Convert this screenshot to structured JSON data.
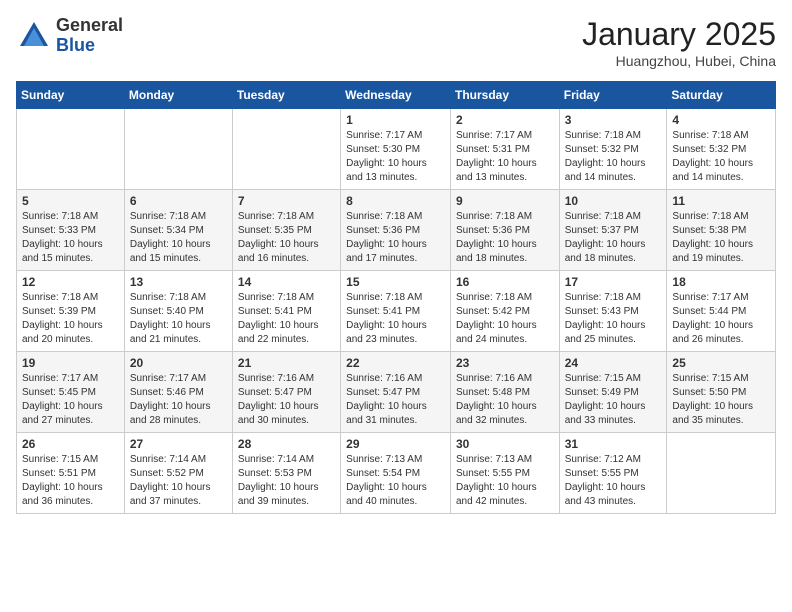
{
  "logo": {
    "general": "General",
    "blue": "Blue"
  },
  "header": {
    "month": "January 2025",
    "location": "Huangzhou, Hubei, China"
  },
  "weekdays": [
    "Sunday",
    "Monday",
    "Tuesday",
    "Wednesday",
    "Thursday",
    "Friday",
    "Saturday"
  ],
  "weeks": [
    [
      {
        "day": "",
        "sunrise": "",
        "sunset": "",
        "daylight": ""
      },
      {
        "day": "",
        "sunrise": "",
        "sunset": "",
        "daylight": ""
      },
      {
        "day": "",
        "sunrise": "",
        "sunset": "",
        "daylight": ""
      },
      {
        "day": "1",
        "sunrise": "Sunrise: 7:17 AM",
        "sunset": "Sunset: 5:30 PM",
        "daylight": "Daylight: 10 hours and 13 minutes."
      },
      {
        "day": "2",
        "sunrise": "Sunrise: 7:17 AM",
        "sunset": "Sunset: 5:31 PM",
        "daylight": "Daylight: 10 hours and 13 minutes."
      },
      {
        "day": "3",
        "sunrise": "Sunrise: 7:18 AM",
        "sunset": "Sunset: 5:32 PM",
        "daylight": "Daylight: 10 hours and 14 minutes."
      },
      {
        "day": "4",
        "sunrise": "Sunrise: 7:18 AM",
        "sunset": "Sunset: 5:32 PM",
        "daylight": "Daylight: 10 hours and 14 minutes."
      }
    ],
    [
      {
        "day": "5",
        "sunrise": "Sunrise: 7:18 AM",
        "sunset": "Sunset: 5:33 PM",
        "daylight": "Daylight: 10 hours and 15 minutes."
      },
      {
        "day": "6",
        "sunrise": "Sunrise: 7:18 AM",
        "sunset": "Sunset: 5:34 PM",
        "daylight": "Daylight: 10 hours and 15 minutes."
      },
      {
        "day": "7",
        "sunrise": "Sunrise: 7:18 AM",
        "sunset": "Sunset: 5:35 PM",
        "daylight": "Daylight: 10 hours and 16 minutes."
      },
      {
        "day": "8",
        "sunrise": "Sunrise: 7:18 AM",
        "sunset": "Sunset: 5:36 PM",
        "daylight": "Daylight: 10 hours and 17 minutes."
      },
      {
        "day": "9",
        "sunrise": "Sunrise: 7:18 AM",
        "sunset": "Sunset: 5:36 PM",
        "daylight": "Daylight: 10 hours and 18 minutes."
      },
      {
        "day": "10",
        "sunrise": "Sunrise: 7:18 AM",
        "sunset": "Sunset: 5:37 PM",
        "daylight": "Daylight: 10 hours and 18 minutes."
      },
      {
        "day": "11",
        "sunrise": "Sunrise: 7:18 AM",
        "sunset": "Sunset: 5:38 PM",
        "daylight": "Daylight: 10 hours and 19 minutes."
      }
    ],
    [
      {
        "day": "12",
        "sunrise": "Sunrise: 7:18 AM",
        "sunset": "Sunset: 5:39 PM",
        "daylight": "Daylight: 10 hours and 20 minutes."
      },
      {
        "day": "13",
        "sunrise": "Sunrise: 7:18 AM",
        "sunset": "Sunset: 5:40 PM",
        "daylight": "Daylight: 10 hours and 21 minutes."
      },
      {
        "day": "14",
        "sunrise": "Sunrise: 7:18 AM",
        "sunset": "Sunset: 5:41 PM",
        "daylight": "Daylight: 10 hours and 22 minutes."
      },
      {
        "day": "15",
        "sunrise": "Sunrise: 7:18 AM",
        "sunset": "Sunset: 5:41 PM",
        "daylight": "Daylight: 10 hours and 23 minutes."
      },
      {
        "day": "16",
        "sunrise": "Sunrise: 7:18 AM",
        "sunset": "Sunset: 5:42 PM",
        "daylight": "Daylight: 10 hours and 24 minutes."
      },
      {
        "day": "17",
        "sunrise": "Sunrise: 7:18 AM",
        "sunset": "Sunset: 5:43 PM",
        "daylight": "Daylight: 10 hours and 25 minutes."
      },
      {
        "day": "18",
        "sunrise": "Sunrise: 7:17 AM",
        "sunset": "Sunset: 5:44 PM",
        "daylight": "Daylight: 10 hours and 26 minutes."
      }
    ],
    [
      {
        "day": "19",
        "sunrise": "Sunrise: 7:17 AM",
        "sunset": "Sunset: 5:45 PM",
        "daylight": "Daylight: 10 hours and 27 minutes."
      },
      {
        "day": "20",
        "sunrise": "Sunrise: 7:17 AM",
        "sunset": "Sunset: 5:46 PM",
        "daylight": "Daylight: 10 hours and 28 minutes."
      },
      {
        "day": "21",
        "sunrise": "Sunrise: 7:16 AM",
        "sunset": "Sunset: 5:47 PM",
        "daylight": "Daylight: 10 hours and 30 minutes."
      },
      {
        "day": "22",
        "sunrise": "Sunrise: 7:16 AM",
        "sunset": "Sunset: 5:47 PM",
        "daylight": "Daylight: 10 hours and 31 minutes."
      },
      {
        "day": "23",
        "sunrise": "Sunrise: 7:16 AM",
        "sunset": "Sunset: 5:48 PM",
        "daylight": "Daylight: 10 hours and 32 minutes."
      },
      {
        "day": "24",
        "sunrise": "Sunrise: 7:15 AM",
        "sunset": "Sunset: 5:49 PM",
        "daylight": "Daylight: 10 hours and 33 minutes."
      },
      {
        "day": "25",
        "sunrise": "Sunrise: 7:15 AM",
        "sunset": "Sunset: 5:50 PM",
        "daylight": "Daylight: 10 hours and 35 minutes."
      }
    ],
    [
      {
        "day": "26",
        "sunrise": "Sunrise: 7:15 AM",
        "sunset": "Sunset: 5:51 PM",
        "daylight": "Daylight: 10 hours and 36 minutes."
      },
      {
        "day": "27",
        "sunrise": "Sunrise: 7:14 AM",
        "sunset": "Sunset: 5:52 PM",
        "daylight": "Daylight: 10 hours and 37 minutes."
      },
      {
        "day": "28",
        "sunrise": "Sunrise: 7:14 AM",
        "sunset": "Sunset: 5:53 PM",
        "daylight": "Daylight: 10 hours and 39 minutes."
      },
      {
        "day": "29",
        "sunrise": "Sunrise: 7:13 AM",
        "sunset": "Sunset: 5:54 PM",
        "daylight": "Daylight: 10 hours and 40 minutes."
      },
      {
        "day": "30",
        "sunrise": "Sunrise: 7:13 AM",
        "sunset": "Sunset: 5:55 PM",
        "daylight": "Daylight: 10 hours and 42 minutes."
      },
      {
        "day": "31",
        "sunrise": "Sunrise: 7:12 AM",
        "sunset": "Sunset: 5:55 PM",
        "daylight": "Daylight: 10 hours and 43 minutes."
      },
      {
        "day": "",
        "sunrise": "",
        "sunset": "",
        "daylight": ""
      }
    ]
  ]
}
